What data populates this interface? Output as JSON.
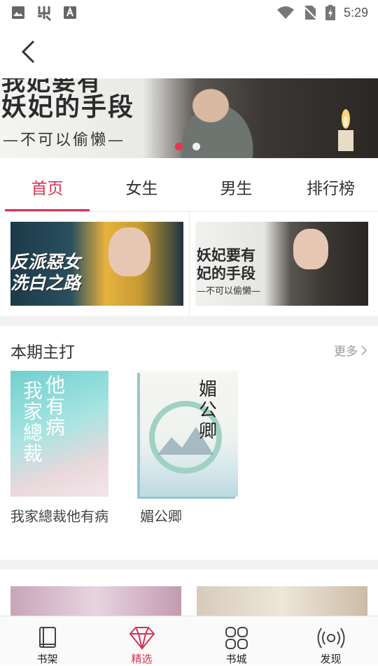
{
  "status_bar": {
    "time": "5:29",
    "icons": [
      "image-icon",
      "bug-icon",
      "font-icon",
      "wifi-icon",
      "no-sim-icon",
      "battery-charging-icon"
    ]
  },
  "app_bar": {
    "back_icon": "back-arrow-icon"
  },
  "banner": {
    "title_partial": "我妃要有",
    "title": "妖妃的手段",
    "subtitle": "—不可以偷懒—",
    "dots": 2,
    "active_dot": 0
  },
  "tabs": [
    {
      "label": "首页",
      "active": true
    },
    {
      "label": "女生",
      "active": false
    },
    {
      "label": "男生",
      "active": false
    },
    {
      "label": "排行榜",
      "active": false
    }
  ],
  "promos": {
    "left": {
      "line1": "反派惡女",
      "line2": "洗白之路"
    },
    "right": {
      "line1": "妖妃要有",
      "line2": "妃的手段",
      "line3": "—不可以偷懒—"
    }
  },
  "featured": {
    "title": "本期主打",
    "more_label": "更多",
    "books": [
      {
        "title": "我家總裁他有病",
        "cover_text_a": "我家總裁",
        "cover_text_b": "他有病"
      },
      {
        "title": "媚公卿",
        "cover_text": "媚公卿"
      }
    ]
  },
  "bottom_nav": [
    {
      "label": "书架",
      "icon": "book-icon",
      "active": false
    },
    {
      "label": "精选",
      "icon": "diamond-icon",
      "active": true
    },
    {
      "label": "书城",
      "icon": "grid-icon",
      "active": false
    },
    {
      "label": "发现",
      "icon": "broadcast-icon",
      "active": false
    }
  ],
  "colors": {
    "accent": "#d63453",
    "dot_active": "#e8344e",
    "text": "#333333",
    "muted": "#999999"
  }
}
